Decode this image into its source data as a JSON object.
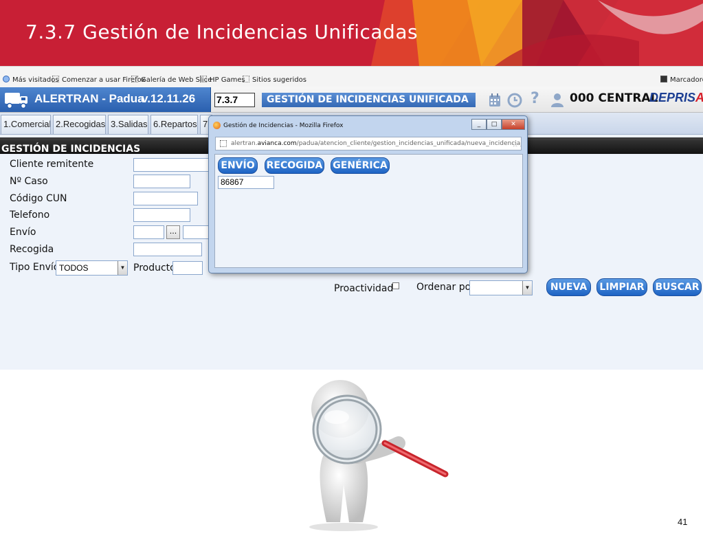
{
  "slide": {
    "title": "7.3.7 Gestión de Incidencias Unificadas",
    "page_number": "41"
  },
  "bookmarks": {
    "items": [
      "Más visitados",
      "Comenzar a usar Firefox",
      "Galería de Web Slice",
      "HP Games",
      "Sitios sugeridos"
    ],
    "right": "Marcadores"
  },
  "app": {
    "name": "ALERTRAN - Padua",
    "version": "v.12.11.26",
    "code": "7.3.7",
    "module_title": "GESTIÓN DE INCIDENCIAS UNIFICADA",
    "central": "000 CENTRAL",
    "logo_main": "DEPRIS",
    "logo_end": "A",
    "icons": [
      "calendar-icon",
      "clock-icon",
      "help-icon",
      "user-icon"
    ]
  },
  "tabs": [
    "1.Comercial",
    "2.Recogidas",
    "3.Salidas",
    "6.Repartos",
    "7."
  ],
  "form": {
    "section_title": "GESTIÓN DE INCIDENCIAS",
    "cliente_remitente": "Cliente remitente",
    "num_caso": "Nº Caso",
    "codigo_cun": "Código CUN",
    "telefono": "Telefono",
    "envio": "Envío",
    "envio_button": "...",
    "recogida": "Recogida",
    "tipo_envio": "Tipo Envío",
    "tipo_envio_value": "TODOS",
    "producto": "Producto",
    "proactividad": "Proactividad",
    "ordenar_por": "Ordenar por",
    "ordenar_por_value": ""
  },
  "actions": {
    "nueva": "NUEVA",
    "limpiar": "LIMPIAR",
    "buscar": "BUSCAR"
  },
  "popup": {
    "title": "Gestión de Incidencias - Mozilla Firefox",
    "url_prefix": "alertran.",
    "url_domain": "avianca.com",
    "url_path": "/padua/atencion_cliente/gestion_incidencias_unificada/nueva_incidencia_unific",
    "btn_envio": "ENVÍO",
    "btn_recogida": "RECOGIDA",
    "btn_generica": "GENÉRICA",
    "input_value": "86867"
  },
  "colors": {
    "banner": "#c81f35",
    "accent_blue": "#2a5fae",
    "button_blue": "#1d63c4"
  }
}
